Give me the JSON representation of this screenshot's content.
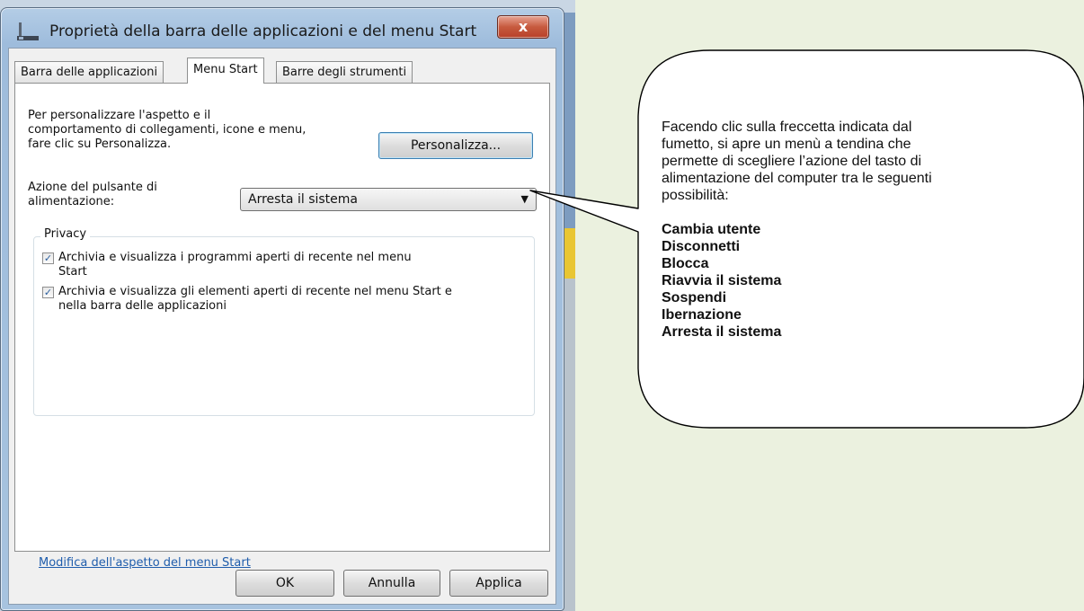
{
  "window": {
    "title": "Proprietà della barra delle applicazioni e del menu Start",
    "close_label": "x"
  },
  "tabs": [
    {
      "label": "Barra delle applicazioni",
      "active": false
    },
    {
      "label": "Menu Start",
      "active": true
    },
    {
      "label": "Barre degli strumenti",
      "active": false
    }
  ],
  "customize": {
    "text": [
      "Per personalizzare l'aspetto e il",
      "comportamento di collegamenti, icone e menu,",
      "fare clic su Personalizza."
    ],
    "button_label": "Personalizza..."
  },
  "power": {
    "label": [
      "Azione del pulsante di",
      "alimentazione:"
    ],
    "selected": "Arresta il sistema"
  },
  "privacy": {
    "title": "Privacy",
    "options": [
      {
        "label": [
          "Archivia e visualizza i programmi aperti di recente nel menu",
          "Start"
        ],
        "checked": true
      },
      {
        "label": [
          "Archivia e visualizza gli elementi aperti di recente nel menu Start e",
          "nella barra delle applicazioni"
        ],
        "checked": true
      }
    ]
  },
  "link_label": "Modifica dell'aspetto del menu Start",
  "buttons": {
    "ok": "OK",
    "cancel": "Annulla",
    "apply": "Applica"
  },
  "callout": {
    "lines": [
      "Facendo clic sulla freccetta indicata dal",
      "fumetto, si apre un menù a tendina che",
      "permette di scegliere l’azione del tasto di",
      "alimentazione del computer tra le seguenti",
      "possibilità:"
    ],
    "options": [
      "Cambia utente",
      "Disconnetti",
      "Blocca",
      "Riavvia il sistema",
      "Sospendi",
      "Ibernazione",
      "Arresta il sistema"
    ]
  }
}
